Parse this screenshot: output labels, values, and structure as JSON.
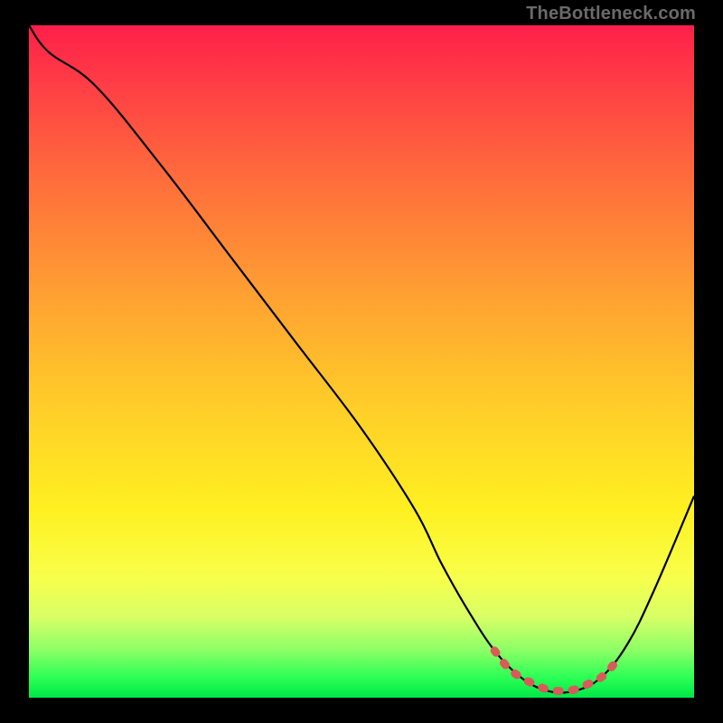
{
  "attribution": "TheBottleneck.com",
  "chart_data": {
    "type": "line",
    "title": "",
    "xlabel": "",
    "ylabel": "",
    "xlim": [
      0,
      100
    ],
    "ylim": [
      0,
      100
    ],
    "series": [
      {
        "name": "bottleneck-curve",
        "x": [
          0,
          3,
          10,
          20,
          30,
          40,
          50,
          58,
          62,
          66,
          70,
          74,
          78,
          82,
          86,
          90,
          94,
          100
        ],
        "values": [
          100,
          96,
          91,
          79,
          66,
          53,
          40,
          28,
          20,
          13,
          7,
          3,
          1,
          1,
          3,
          8,
          16,
          30
        ]
      },
      {
        "name": "optimal-zone",
        "x": [
          70,
          72,
          74,
          76,
          78,
          80,
          82,
          84,
          86,
          88
        ],
        "values": [
          7,
          4.5,
          3,
          2,
          1.2,
          1,
          1.2,
          2,
          3,
          5
        ]
      }
    ],
    "colors": {
      "curve": "#000000",
      "optimal": "#d95a5a"
    }
  }
}
